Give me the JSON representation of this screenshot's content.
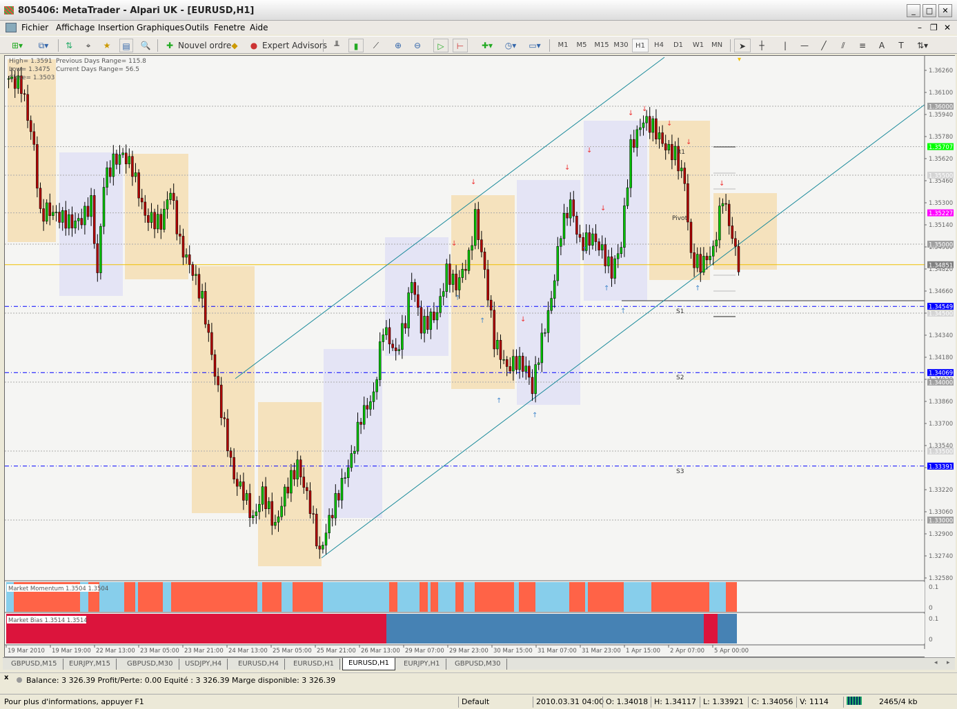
{
  "window": {
    "title": "805406: MetaTrader - Alpari UK - [EURUSD,H1]",
    "minimize": "_",
    "maximize": "□",
    "close": "✕"
  },
  "menu": [
    "Fichier",
    "Affichage",
    "Insertion",
    "Graphiques",
    "Outils",
    "Fenetre",
    "Aide"
  ],
  "toolbar": {
    "new_order": "Nouvel ordre",
    "expert_advisors": "Expert Advisors",
    "timeframes": [
      "M1",
      "M5",
      "M15",
      "M30",
      "H1",
      "H4",
      "D1",
      "W1",
      "MN"
    ],
    "active_timeframe": "H1"
  },
  "info": {
    "high": "High= 1.3591",
    "low": "Low= 1.3475",
    "close": "Close= 1.3503",
    "prev_range": "Previous Days Range= 115.8",
    "cur_range": "Current Days Range= 56.5"
  },
  "levels": {
    "r1": "R1",
    "pivot": "Pivot",
    "s1": "S1",
    "s2": "S2",
    "s3": "S3"
  },
  "chart_data": {
    "type": "candlestick",
    "symbol": "EURUSD,H1",
    "ylim": [
      1.325,
      1.3634
    ],
    "price_ticks": [
      "1.36260",
      "1.36100",
      "1.35940",
      "1.35780",
      "1.35620",
      "1.35460",
      "1.35300",
      "1.35140",
      "1.34980",
      "1.34820",
      "1.34660",
      "1.34500",
      "1.34340",
      "1.34180",
      "1.34020",
      "1.33860",
      "1.33700",
      "1.33540",
      "1.33380",
      "1.33220",
      "1.33060",
      "1.32900",
      "1.32740",
      "1.32580"
    ],
    "price_labels": [
      {
        "value": "1.36000",
        "color": "#a0a0a0"
      },
      {
        "value": "1.35707",
        "color": "#00ff00"
      },
      {
        "value": "1.35500",
        "color": "#d4d4d4"
      },
      {
        "value": "1.35227",
        "color": "#ff00ff"
      },
      {
        "value": "1.35000",
        "color": "#a0a0a0"
      },
      {
        "value": "1.34851",
        "color": "#808080"
      },
      {
        "value": "1.34549",
        "color": "#0000ff"
      },
      {
        "value": "1.34500",
        "color": "#d4d4d4"
      },
      {
        "value": "1.34069",
        "color": "#0000ff"
      },
      {
        "value": "1.34000",
        "color": "#a0a0a0"
      },
      {
        "value": "1.33500",
        "color": "#d4d4d4"
      },
      {
        "value": "1.33391",
        "color": "#0000ff"
      },
      {
        "value": "1.33000",
        "color": "#a0a0a0"
      }
    ],
    "close_path": [
      [
        0,
        1.362
      ],
      [
        4,
        1.3615
      ],
      [
        8,
        1.357
      ],
      [
        10,
        1.352
      ],
      [
        12,
        1.3525
      ],
      [
        16,
        1.352
      ],
      [
        20,
        1.3515
      ],
      [
        23,
        1.3518
      ],
      [
        26,
        1.353
      ],
      [
        28,
        1.3478
      ],
      [
        30,
        1.3545
      ],
      [
        33,
        1.356
      ],
      [
        36,
        1.3565
      ],
      [
        39,
        1.3555
      ],
      [
        43,
        1.352
      ],
      [
        48,
        1.3515
      ],
      [
        51,
        1.354
      ],
      [
        54,
        1.35
      ],
      [
        58,
        1.348
      ],
      [
        61,
        1.346
      ],
      [
        64,
        1.342
      ],
      [
        67,
        1.338
      ],
      [
        71,
        1.333
      ],
      [
        74,
        1.332
      ],
      [
        77,
        1.33
      ],
      [
        80,
        1.332
      ],
      [
        84,
        1.3295
      ],
      [
        87,
        1.332
      ],
      [
        91,
        1.334
      ],
      [
        95,
        1.331
      ],
      [
        98,
        1.3275
      ],
      [
        101,
        1.33
      ],
      [
        104,
        1.332
      ],
      [
        108,
        1.3345
      ],
      [
        111,
        1.3375
      ],
      [
        115,
        1.339
      ],
      [
        118,
        1.344
      ],
      [
        122,
        1.342
      ],
      [
        125,
        1.3445
      ],
      [
        127,
        1.3475
      ],
      [
        130,
        1.344
      ],
      [
        135,
        1.345
      ],
      [
        138,
        1.348
      ],
      [
        141,
        1.347
      ],
      [
        145,
        1.349
      ],
      [
        147,
        1.352
      ],
      [
        150,
        1.348
      ],
      [
        153,
        1.343
      ],
      [
        157,
        1.341
      ],
      [
        160,
        1.3415
      ],
      [
        163,
        1.341
      ],
      [
        165,
        1.3395
      ],
      [
        167,
        1.342
      ],
      [
        171,
        1.346
      ],
      [
        174,
        1.351
      ],
      [
        177,
        1.353
      ],
      [
        180,
        1.35
      ],
      [
        184,
        1.3505
      ],
      [
        187,
        1.3495
      ],
      [
        190,
        1.348
      ],
      [
        193,
        1.35
      ],
      [
        196,
        1.357
      ],
      [
        200,
        1.359
      ],
      [
        203,
        1.3585
      ],
      [
        207,
        1.357
      ],
      [
        210,
        1.3565
      ],
      [
        213,
        1.3545
      ],
      [
        215,
        1.349
      ],
      [
        218,
        1.3485
      ],
      [
        222,
        1.3495
      ],
      [
        225,
        1.3535
      ],
      [
        227,
        1.3515
      ],
      [
        230,
        1.3485
      ]
    ],
    "time_labels": [
      "19 Mar 2010",
      "19 Mar 19:00",
      "22 Mar 13:00",
      "23 Mar 05:00",
      "23 Mar 21:00",
      "24 Mar 13:00",
      "25 Mar 05:00",
      "25 Mar 21:00",
      "26 Mar 13:00",
      "29 Mar 07:00",
      "29 Mar 23:00",
      "30 Mar 15:00",
      "31 Mar 07:00",
      "31 Mar 23:00",
      "1 Apr 15:00",
      "2 Apr 07:00",
      "5 Apr 00:00"
    ],
    "momentum": {
      "label": "Market Momentum 1.3504 1.3504",
      "scale_top": "0.1",
      "scale_bottom": "0"
    },
    "bias": {
      "label": "Market Bias 1.3514 1.3514",
      "scale_top": "0.1",
      "scale_bottom": "0"
    },
    "colors": {
      "up": "#00c000",
      "down": "#b00000",
      "momentum_up": "#87ceeb",
      "momentum_down": "#ff6347",
      "bias_down": "#dc143c",
      "bias_up": "#4682b4",
      "current_price": "#f0c000"
    }
  },
  "tabs": [
    "GBPUSD,M15",
    "EURJPY,M15",
    "GBPUSD,M30",
    "USDJPY,H4",
    "EURUSD,H4",
    "EURUSD,H1",
    "EURUSD,H1",
    "EURJPY,H1",
    "GBPUSD,M30"
  ],
  "active_tab": 6,
  "terminal": {
    "close": "x",
    "text": "Balance: 3 326.39  Profit/Perte: 0.00  Equité : 3 326.39  Marge disponible: 3 326.39"
  },
  "status": {
    "help": "Pour plus d'informations, appuyer F1",
    "profile": "Default",
    "datetime": "2010.03.31 04:00",
    "open": "O: 1.34018",
    "high": "H: 1.34117",
    "low": "L: 1.33921",
    "close": "C: 1.34056",
    "volume": "V: 1114",
    "traffic": "2465/4 kb"
  }
}
